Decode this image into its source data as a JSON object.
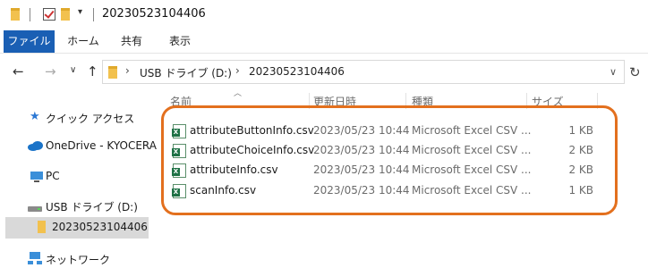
{
  "window": {
    "title": "20230523104406"
  },
  "ribbon": {
    "tabs": [
      "ファイル",
      "ホーム",
      "共有",
      "表示"
    ]
  },
  "address": {
    "segments": [
      "USB ドライブ (D:)",
      "20230523104406"
    ]
  },
  "navpane": {
    "items": [
      {
        "label": "クイック アクセス",
        "icon": "star-icon"
      },
      {
        "label": "OneDrive - KYOCERA",
        "icon": "cloud-icon"
      },
      {
        "label": "PC",
        "icon": "pc-icon"
      },
      {
        "label": "USB ドライブ (D:)",
        "icon": "usb-drive-icon"
      },
      {
        "label": "20230523104406",
        "icon": "folder-icon",
        "selected": true
      },
      {
        "label": "ネットワーク",
        "icon": "network-icon"
      }
    ]
  },
  "columns": {
    "name": "名前",
    "date": "更新日時",
    "type": "種類",
    "size": "サイズ"
  },
  "files": [
    {
      "name": "attributeButtonInfo.csv",
      "date": "2023/05/23 10:44",
      "type": "Microsoft Excel CSV ...",
      "size": "1 KB"
    },
    {
      "name": "attributeChoiceInfo.csv",
      "date": "2023/05/23 10:44",
      "type": "Microsoft Excel CSV ...",
      "size": "2 KB"
    },
    {
      "name": "attributeInfo.csv",
      "date": "2023/05/23 10:44",
      "type": "Microsoft Excel CSV ...",
      "size": "2 KB"
    },
    {
      "name": "scanInfo.csv",
      "date": "2023/05/23 10:44",
      "type": "Microsoft Excel CSV ...",
      "size": "1 KB"
    }
  ],
  "colors": {
    "accent": "#1a5fb4",
    "highlight": "#e3701e",
    "folder": "#f2c14e",
    "excel": "#1e7145"
  }
}
